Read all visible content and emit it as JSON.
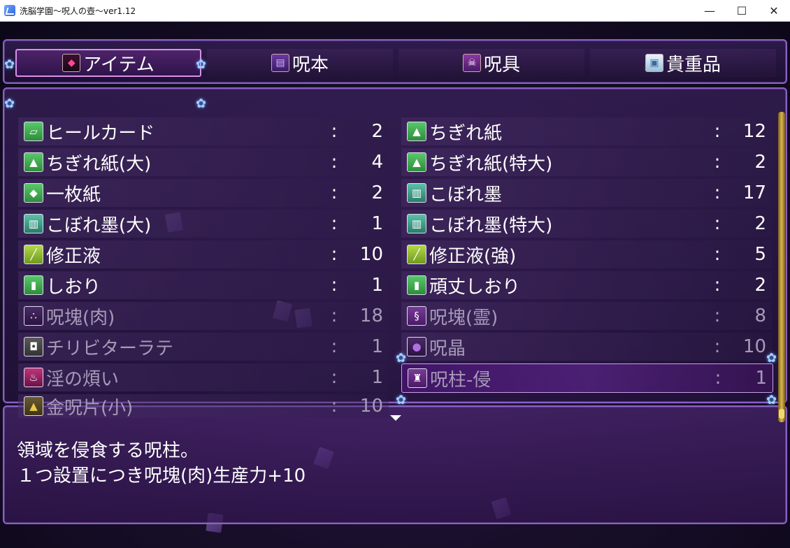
{
  "window": {
    "title": "洗脳学園～呪人の壺～ver1.12",
    "minimize_glyph": "—",
    "maximize_glyph": "☐",
    "close_glyph": "✕"
  },
  "tabs": [
    {
      "label": "アイテム",
      "icon": "gem-icon",
      "active": true
    },
    {
      "label": "呪本",
      "icon": "spellbook-icon",
      "active": false
    },
    {
      "label": "呪具",
      "icon": "skeleton-icon",
      "active": false
    },
    {
      "label": "貴重品",
      "icon": "valuable-icon",
      "active": false
    }
  ],
  "items_left": [
    {
      "name": "ヒールカード",
      "colon": ":",
      "qty": "2",
      "icon": "card-icon"
    },
    {
      "name": "ちぎれ紙(大)",
      "colon": ":",
      "qty": "4",
      "icon": "torn-paper-icon"
    },
    {
      "name": "一枚紙",
      "colon": ":",
      "qty": "2",
      "icon": "paper-sheet-icon"
    },
    {
      "name": "こぼれ墨(大)",
      "colon": ":",
      "qty": "1",
      "icon": "ink-jar-icon"
    },
    {
      "name": "修正液",
      "colon": ":",
      "qty": "10",
      "icon": "correction-fluid-icon"
    },
    {
      "name": "しおり",
      "colon": ":",
      "qty": "1",
      "icon": "bookmark-icon"
    },
    {
      "name": "呪塊(肉)",
      "colon": ":",
      "qty": "18",
      "icon": "curse-lump-icon"
    },
    {
      "name": "チリビターラテ",
      "colon": ":",
      "qty": "1",
      "icon": "mug-icon"
    },
    {
      "name": "淫の煩い",
      "colon": ":",
      "qty": "1",
      "icon": "flame-icon"
    },
    {
      "name": "金呪片(小)",
      "colon": ":",
      "qty": "10",
      "icon": "gold-shard-icon"
    }
  ],
  "items_right": [
    {
      "name": "ちぎれ紙",
      "colon": ":",
      "qty": "12",
      "icon": "torn-paper-icon"
    },
    {
      "name": "ちぎれ紙(特大)",
      "colon": ":",
      "qty": "2",
      "icon": "torn-paper-icon"
    },
    {
      "name": "こぼれ墨",
      "colon": ":",
      "qty": "17",
      "icon": "ink-jar-icon"
    },
    {
      "name": "こぼれ墨(特大)",
      "colon": ":",
      "qty": "2",
      "icon": "ink-jar-icon"
    },
    {
      "name": "修正液(強)",
      "colon": ":",
      "qty": "5",
      "icon": "correction-fluid-icon"
    },
    {
      "name": "頑丈しおり",
      "colon": ":",
      "qty": "2",
      "icon": "bookmark-icon"
    },
    {
      "name": "呪塊(霊)",
      "colon": ":",
      "qty": "8",
      "icon": "spirit-icon"
    },
    {
      "name": "呪晶",
      "colon": ":",
      "qty": "10",
      "icon": "crystal-icon"
    },
    {
      "name": "呪柱-侵",
      "colon": ":",
      "qty": "1",
      "icon": "pillar-icon"
    }
  ],
  "help": {
    "line1": "領域を侵食する呪柱。",
    "line2": "１つ設置につき呪塊(肉)生産力+10"
  }
}
